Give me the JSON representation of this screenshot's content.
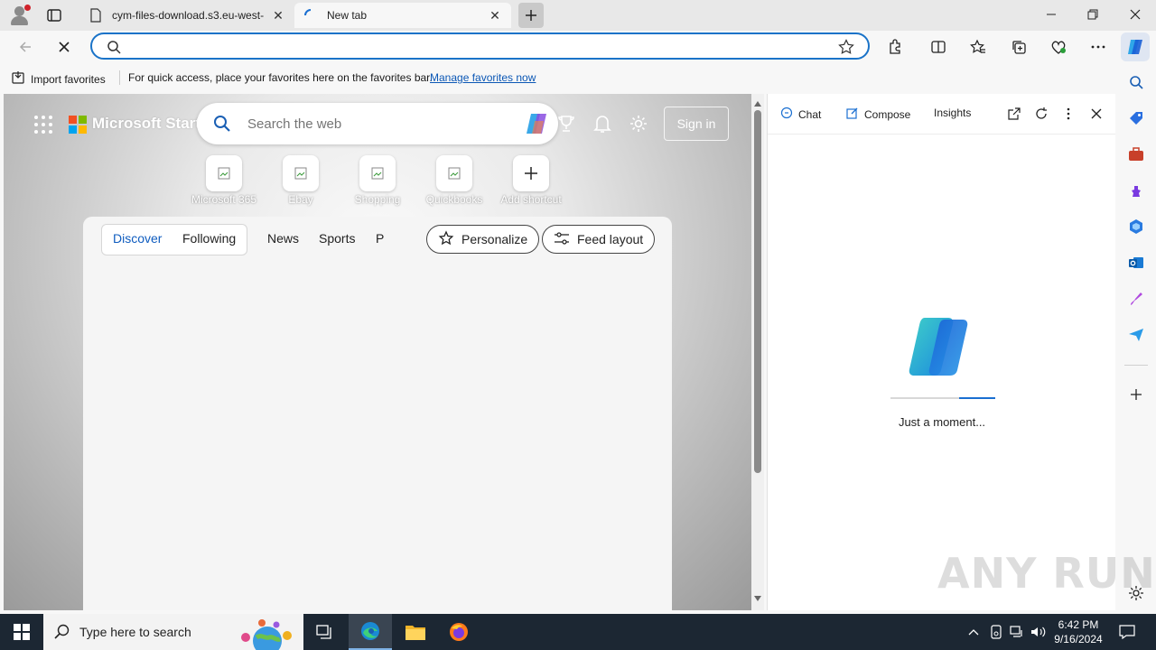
{
  "browser": {
    "tabs": [
      {
        "label": "cym-files-download.s3.eu-west-",
        "active": false
      },
      {
        "label": "New tab",
        "active": true
      }
    ],
    "address": {
      "value": "",
      "placeholder": ""
    },
    "favorites_bar": {
      "import_label": "Import favorites",
      "hint": "For quick access, place your favorites here on the favorites bar.",
      "manage_link": "Manage favorites now"
    }
  },
  "newtab": {
    "brand": "Microsoft Start",
    "search_placeholder": "Search the web",
    "sign_in": "Sign in",
    "shortcuts": [
      {
        "label": "Microsoft 365"
      },
      {
        "label": "Ebay"
      },
      {
        "label": "Shopping"
      },
      {
        "label": "Quickbooks"
      },
      {
        "label": "Add shortcut"
      }
    ],
    "feed_tabs": [
      "Discover",
      "Following",
      "News",
      "Sports",
      "P"
    ],
    "personalize": "Personalize",
    "feed_layout": "Feed layout"
  },
  "copilot_panel": {
    "tabs": [
      "Chat",
      "Compose",
      "Insights"
    ],
    "message": "Just a moment...",
    "progress": 0.35
  },
  "watermark": "ANY RUN",
  "taskbar": {
    "search_placeholder": "Type here to search",
    "time": "6:42 PM",
    "date": "9/16/2024"
  },
  "colors": {
    "accent": "#1a73c8",
    "copilot_blue": "#1a6fd1",
    "taskbar": "#1c2733"
  }
}
